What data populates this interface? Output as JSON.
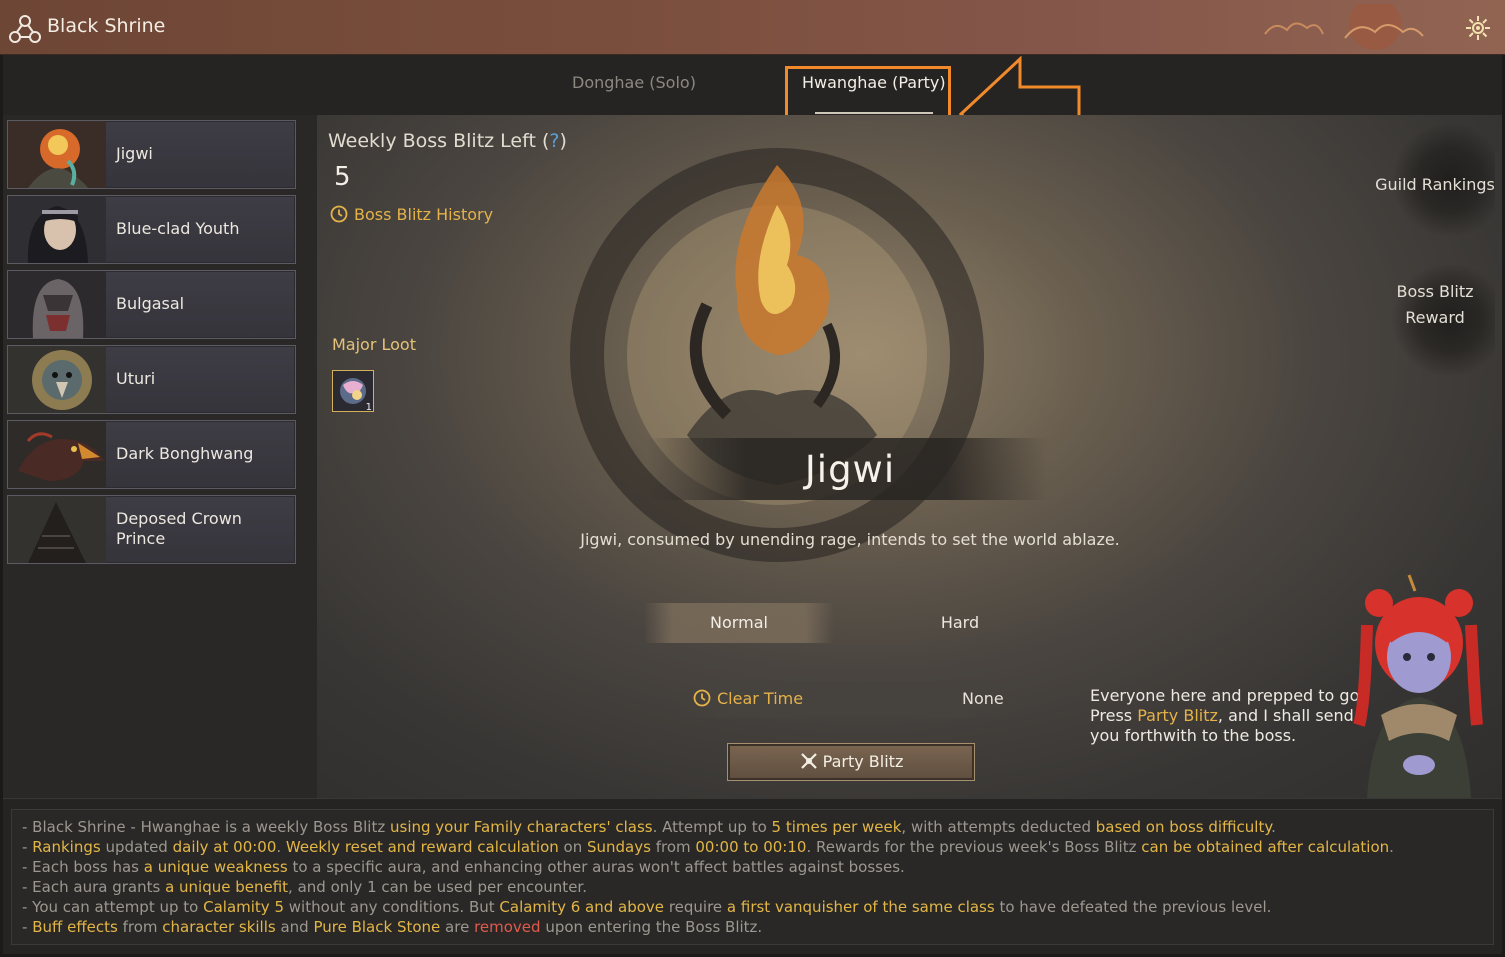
{
  "window": {
    "title": "Black Shrine"
  },
  "tabs": {
    "solo": "Donghae (Solo)",
    "party": "Hwanghae (Party)"
  },
  "bosses": [
    {
      "name": "Jigwi"
    },
    {
      "name": "Blue-clad Youth"
    },
    {
      "name": "Bulgasal"
    },
    {
      "name": "Uturi"
    },
    {
      "name": "Dark Bonghwang"
    },
    {
      "name": "Deposed Crown Prince"
    }
  ],
  "weekly": {
    "label": "Weekly Boss Blitz Left (",
    "help": "?",
    "close": ")",
    "count": "5"
  },
  "history_label": "Boss Blitz History",
  "loot": {
    "label": "Major Loot",
    "count": "1"
  },
  "boss": {
    "name": "Jigwi",
    "description": "Jigwi, consumed by unending rage, intends to set the world ablaze."
  },
  "difficulty": {
    "normal": "Normal",
    "hard": "Hard"
  },
  "clear_time": {
    "label": "Clear Time",
    "value": "None"
  },
  "party_blitz_label": "Party Blitz",
  "side": {
    "rankings": "Guild Rankings",
    "reward_line1": "Boss Blitz",
    "reward_line2": "Reward"
  },
  "npc": {
    "l1": "Everyone here and prepped to go?",
    "l2a": "Press ",
    "l2b": "Party Blitz",
    "l2c": ", and I shall send",
    "l3": "you forthwith to the boss."
  },
  "info": {
    "line1": [
      "- Black Shrine - Hwanghae is a weekly Boss Blitz ",
      "using your Family characters' class",
      ". Attempt up to ",
      "5 times per week",
      ", with attempts deducted ",
      "based on boss difficulty",
      "."
    ],
    "line2": [
      "- ",
      "Rankings",
      " updated ",
      "daily at 00:00",
      ". ",
      "Weekly reset and reward calculation",
      " on ",
      "Sundays",
      " from ",
      "00:00 to 00:10",
      ". Rewards for the previous week's Boss Blitz ",
      "can be obtained after calculation",
      "."
    ],
    "line3": [
      "- Each boss has ",
      "a unique weakness",
      " to a specific aura, and enhancing other auras won't affect battles against bosses."
    ],
    "line4": [
      "- Each aura grants ",
      "a unique benefit",
      ", and only 1 can be used per encounter."
    ],
    "line5": [
      "- You can attempt up to ",
      "Calamity 5",
      " without any conditions. But ",
      "Calamity 6 and above",
      " require ",
      "a first vanquisher of the same class",
      " to have defeated the previous level."
    ],
    "line6": [
      "- ",
      "Buff effects",
      " from ",
      "character skills",
      " and ",
      "Pure Black Stone",
      " are ",
      "removed",
      " upon entering the Boss Blitz."
    ]
  }
}
